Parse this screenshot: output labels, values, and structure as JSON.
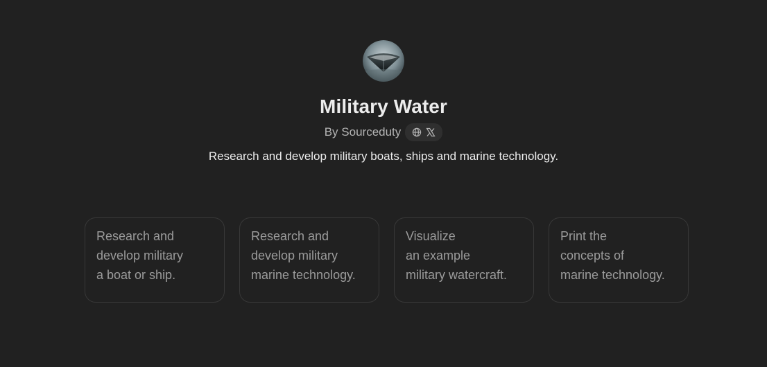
{
  "gpt": {
    "title": "Military Water",
    "author_label": "By Sourceduty",
    "description": "Research and develop military boats, ships and marine technology.",
    "avatar_icon": "warship-bow-icon",
    "social_icons": [
      "globe-icon",
      "x-logo-icon"
    ]
  },
  "starters": [
    {
      "lines": [
        "Research and",
        "develop military",
        "a boat or ship."
      ]
    },
    {
      "lines": [
        "Research and",
        "develop military",
        "marine technology."
      ]
    },
    {
      "lines": [
        "Visualize",
        "an example",
        "military watercraft."
      ]
    },
    {
      "lines": [
        "Print the",
        "concepts of",
        "marine technology."
      ]
    }
  ],
  "colors": {
    "background": "#212121",
    "card_border": "#383838",
    "muted_text": "#9b9b9b",
    "pill_background": "#2f2f2f"
  }
}
